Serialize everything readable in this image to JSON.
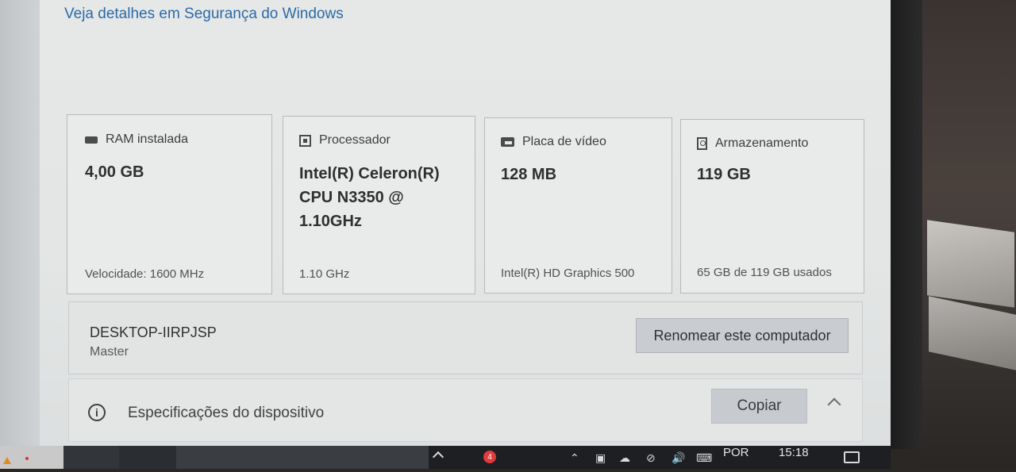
{
  "security_link": "Veja detalhes em Segurança do Windows",
  "cards": [
    {
      "icon": "ram-icon",
      "label": "RAM instalada",
      "value": "4,00 GB",
      "footer": "Velocidade: 1600 MHz"
    },
    {
      "icon": "processor-icon",
      "label": "Processador",
      "value": "Intel(R) Celeron(R) CPU N3350 @ 1.10GHz",
      "footer": "1.10 GHz"
    },
    {
      "icon": "graphics-card-icon",
      "label": "Placa de vídeo",
      "value": "128 MB",
      "footer": "Intel(R) HD Graphics 500"
    },
    {
      "icon": "storage-icon",
      "label": "Armazenamento",
      "value": "119 GB",
      "footer": "65 GB de 119 GB usados"
    }
  ],
  "device": {
    "name": "DESKTOP-IIRPJSP",
    "subtitle": "Master",
    "rename_label": "Renomear este computador"
  },
  "specs": {
    "title": "Especificações do dispositivo",
    "copy_label": "Copiar"
  },
  "taskbar": {
    "badge_count": "4",
    "language": "POR",
    "time": "15:18"
  },
  "colors": {
    "link": "#2b6aa6",
    "button": "#c9cdd1",
    "badge": "#e23b3b"
  }
}
